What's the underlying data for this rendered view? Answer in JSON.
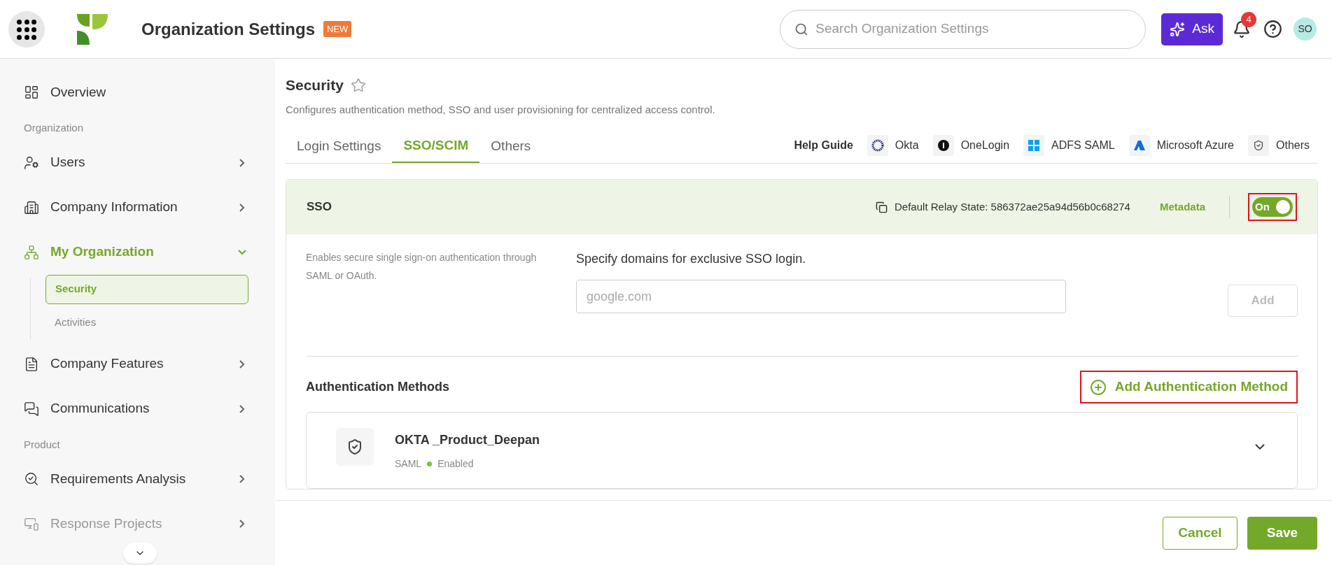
{
  "header": {
    "title": "Organization Settings",
    "badge": "NEW",
    "search": {
      "placeholder": "Search Organization Settings"
    },
    "ask_button": "Ask",
    "notifications": "4",
    "avatar": "SO"
  },
  "sidebar": {
    "items": [
      {
        "kind": "link",
        "label": "Overview",
        "selected": false,
        "disabled": false
      },
      {
        "kind": "section",
        "label": "Organization"
      },
      {
        "kind": "item",
        "label": "Users",
        "selected": false,
        "expanded": false,
        "disabled": false
      },
      {
        "kind": "item",
        "label": "Company Information",
        "selected": false,
        "expanded": false,
        "disabled": false
      },
      {
        "kind": "item",
        "label": "My Organization",
        "selected": true,
        "expanded": true,
        "disabled": false,
        "children": [
          {
            "label": "Security",
            "selected": true
          },
          {
            "label": "Activities",
            "selected": false
          }
        ]
      },
      {
        "kind": "item",
        "label": "Company Features",
        "selected": false,
        "expanded": false,
        "disabled": false
      },
      {
        "kind": "item",
        "label": "Communications",
        "selected": false,
        "expanded": false,
        "disabled": false
      },
      {
        "kind": "section",
        "label": "Product"
      },
      {
        "kind": "item",
        "label": "Requirements Analysis",
        "selected": false,
        "expanded": false,
        "disabled": false
      },
      {
        "kind": "item",
        "label": "Response Projects",
        "selected": false,
        "expanded": false,
        "disabled": true
      }
    ]
  },
  "page": {
    "title": "Security",
    "description": "Configures authentication method, SSO and user provisioning for centralized access control."
  },
  "tabs": [
    {
      "label": "Login Settings",
      "selected": false
    },
    {
      "label": "SSO/SCIM",
      "selected": true
    },
    {
      "label": "Others",
      "selected": false
    }
  ],
  "help_guide": {
    "label": "Help Guide",
    "links": [
      "Okta",
      "OneLogin",
      "ADFS SAML",
      "Microsoft Azure",
      "Others"
    ]
  },
  "sso": {
    "title": "SSO",
    "relay_state": "Default Relay State: 586372ae25a94d56b0c68274",
    "metadata_link": "Metadata",
    "toggle": {
      "label": "On",
      "on": true,
      "highlighted": true
    },
    "description": "Enables secure single sign-on authentication through SAML or OAuth.",
    "domains": {
      "label": "Specify domains for exclusive SSO login.",
      "placeholder": "google.com",
      "add_button": "Add",
      "add_disabled": true
    }
  },
  "auth": {
    "title": "Authentication Methods",
    "add_button": {
      "label": "Add Authentication Method",
      "highlighted": true
    },
    "methods": [
      {
        "name": "OKTA _Product_Deepan",
        "type": "SAML",
        "status": "Enabled",
        "enabled": true
      }
    ]
  },
  "footer": {
    "cancel": "Cancel",
    "save": "Save"
  }
}
